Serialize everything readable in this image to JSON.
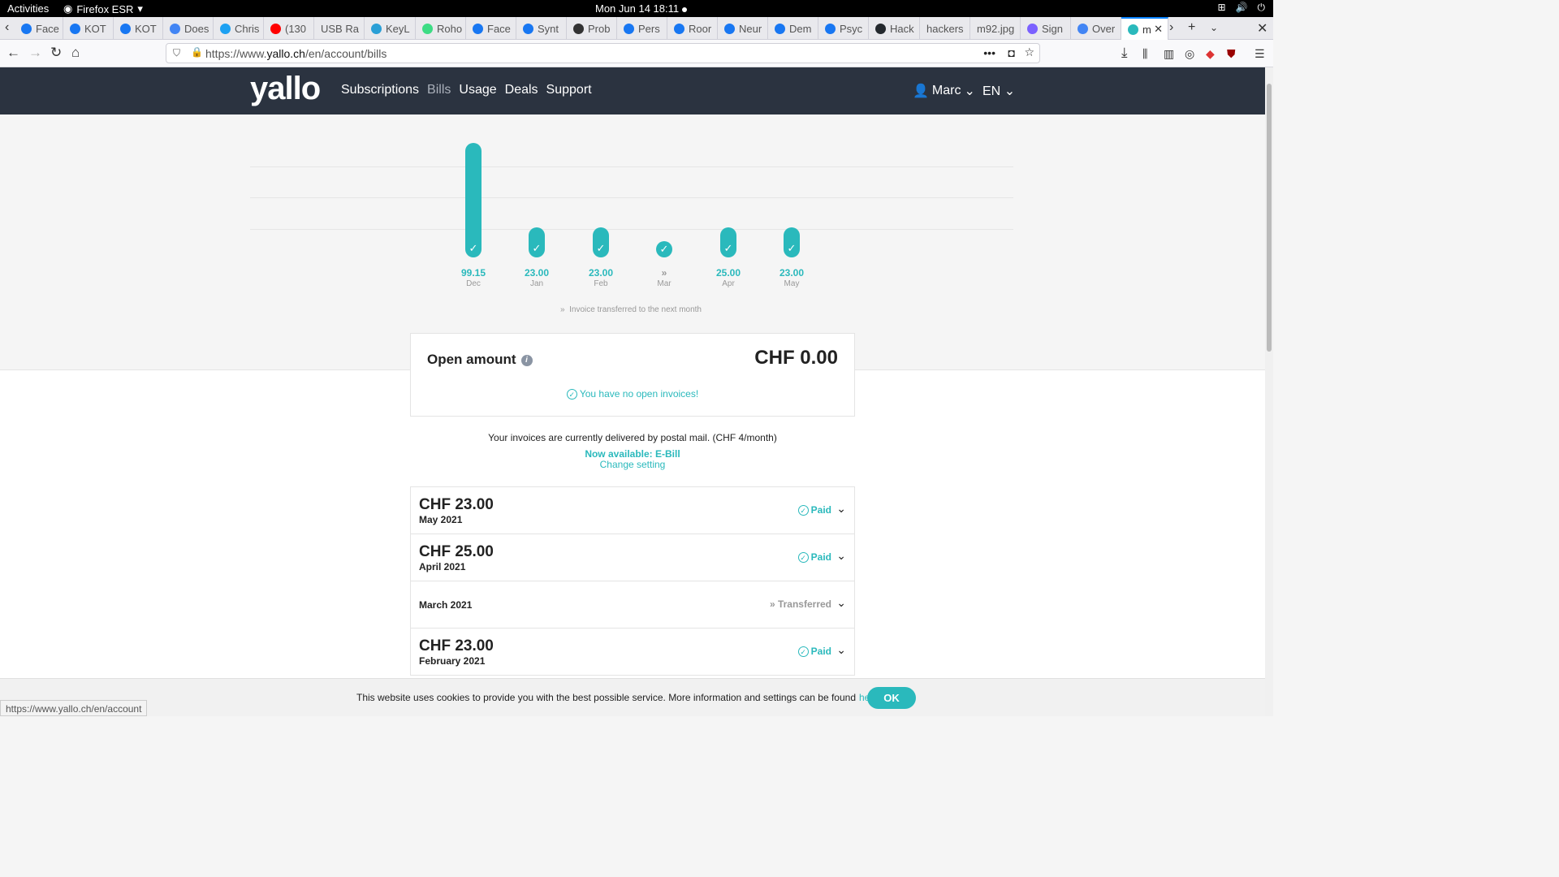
{
  "system": {
    "activities": "Activities",
    "app": "Firefox ESR",
    "clock": "Mon Jun 14  18:11"
  },
  "tabs": [
    {
      "label": "Face",
      "color": "#1877f2"
    },
    {
      "label": "KOT",
      "color": "#1877f2"
    },
    {
      "label": "KOT",
      "color": "#1877f2"
    },
    {
      "label": "Does",
      "color": "#4285f4"
    },
    {
      "label": "Chris",
      "color": "#1da1f2"
    },
    {
      "label": "(130",
      "color": "#ff0000"
    },
    {
      "label": "USB Ra",
      "color": ""
    },
    {
      "label": "KeyL",
      "color": "#2a9fd6"
    },
    {
      "label": "Roho",
      "color": "#3ddc84"
    },
    {
      "label": "Face",
      "color": "#1877f2"
    },
    {
      "label": "Synt",
      "color": "#1877f2"
    },
    {
      "label": "Prob",
      "color": "#333333"
    },
    {
      "label": "Pers",
      "color": "#1877f2"
    },
    {
      "label": "Roor",
      "color": "#1877f2"
    },
    {
      "label": "Neur",
      "color": "#1877f2"
    },
    {
      "label": "Dem",
      "color": "#1877f2"
    },
    {
      "label": "Psyc",
      "color": "#1877f2"
    },
    {
      "label": "Hack",
      "color": "#24292e"
    },
    {
      "label": "hackers",
      "color": ""
    },
    {
      "label": "m92.jpg",
      "color": ""
    },
    {
      "label": "Sign",
      "color": "#7b61ff"
    },
    {
      "label": "Over",
      "color": "#4285f4"
    },
    {
      "label": "m",
      "color": "#2ab9bc"
    }
  ],
  "urlbar": {
    "prefix": "https://www.",
    "domain": "yallo.ch",
    "path": "/en/account/bills"
  },
  "site": {
    "logo": "yallo",
    "menu": [
      "Subscriptions",
      "Bills",
      "Usage",
      "Deals",
      "Support"
    ],
    "user": "Marc",
    "lang": "EN"
  },
  "chart_data": {
    "type": "bar",
    "categories": [
      "Dec",
      "Jan",
      "Feb",
      "Mar",
      "Apr",
      "May"
    ],
    "values": [
      99.15,
      23.0,
      23.0,
      null,
      25.0,
      23.0
    ],
    "labels": [
      "99.15",
      "23.00",
      "23.00",
      "»",
      "25.00",
      "23.00"
    ],
    "legend": "Invoice transferred to the next month",
    "accent": "#2ab9bc"
  },
  "open": {
    "title": "Open amount",
    "amount": "CHF 0.00",
    "none": "You have no open invoices!"
  },
  "delivery": {
    "text": "Your invoices are currently delivered by postal mail. (CHF 4/month)",
    "ebill": "Now available: E-Bill",
    "change": "Change setting"
  },
  "invoices": [
    {
      "amount": "CHF 23.00",
      "period": "May 2021",
      "status": "Paid"
    },
    {
      "amount": "CHF 25.00",
      "period": "April 2021",
      "status": "Paid"
    },
    {
      "amount": "",
      "period": "March 2021",
      "status": "Transferred"
    },
    {
      "amount": "CHF 23.00",
      "period": "February 2021",
      "status": "Paid"
    }
  ],
  "cookie": {
    "text": "This website uses cookies to provide you with the best possible service. More information and settings can be found",
    "link": "here",
    "ok": "OK"
  },
  "status_url": "https://www.yallo.ch/en/account"
}
